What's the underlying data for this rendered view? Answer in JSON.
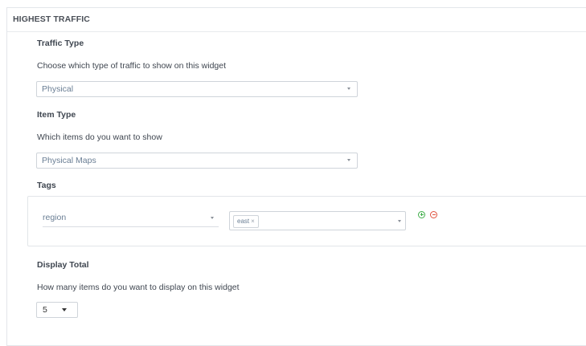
{
  "panel": {
    "title": "HIGHEST TRAFFIC"
  },
  "traffic_type": {
    "label": "Traffic Type",
    "description": "Choose which type of traffic to show on this widget",
    "selected": "Physical"
  },
  "item_type": {
    "label": "Item Type",
    "description": "Which items do you want to show",
    "selected": "Physical Maps"
  },
  "tags": {
    "label": "Tags",
    "key": "region",
    "values": [
      {
        "label": "east",
        "remove_glyph": "×"
      }
    ],
    "add_icon": "plus-circle-icon",
    "remove_icon": "minus-circle-icon",
    "colors": {
      "add": "#3fae49",
      "remove": "#e0503c"
    }
  },
  "display_total": {
    "label": "Display Total",
    "description": "How many items do you want to display on this widget",
    "selected": "5"
  }
}
